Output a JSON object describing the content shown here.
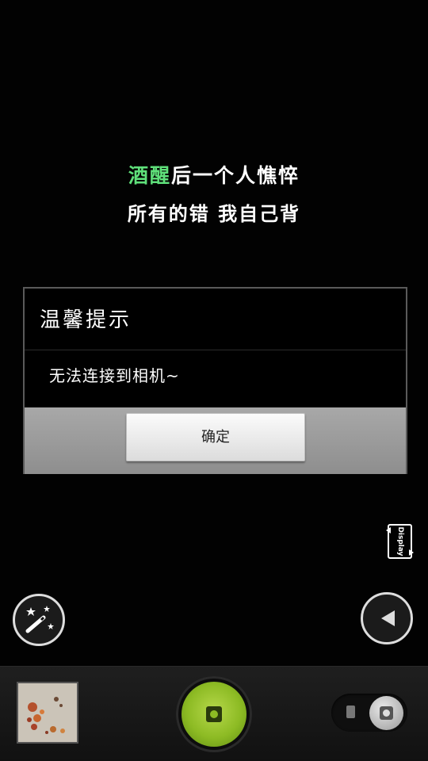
{
  "wallpaper": {
    "quote_line1_accent": "酒醒",
    "quote_line1_rest": "后一个人憔悴",
    "quote_line2": "所有的错 我自己背"
  },
  "dialog": {
    "title": "温馨提示",
    "message": "无法连接到相机~",
    "ok_label": "确定"
  },
  "controls": {
    "display_label": "Display",
    "effects_icon": "magic-wand-icon",
    "back_icon": "back-arrow-icon",
    "shutter_icon": "camera-icon",
    "mode_switch_icons": [
      "video-icon",
      "camera-icon"
    ]
  },
  "colors": {
    "accent_green": "#5fe07a",
    "shutter_green": "#8dbb24"
  }
}
